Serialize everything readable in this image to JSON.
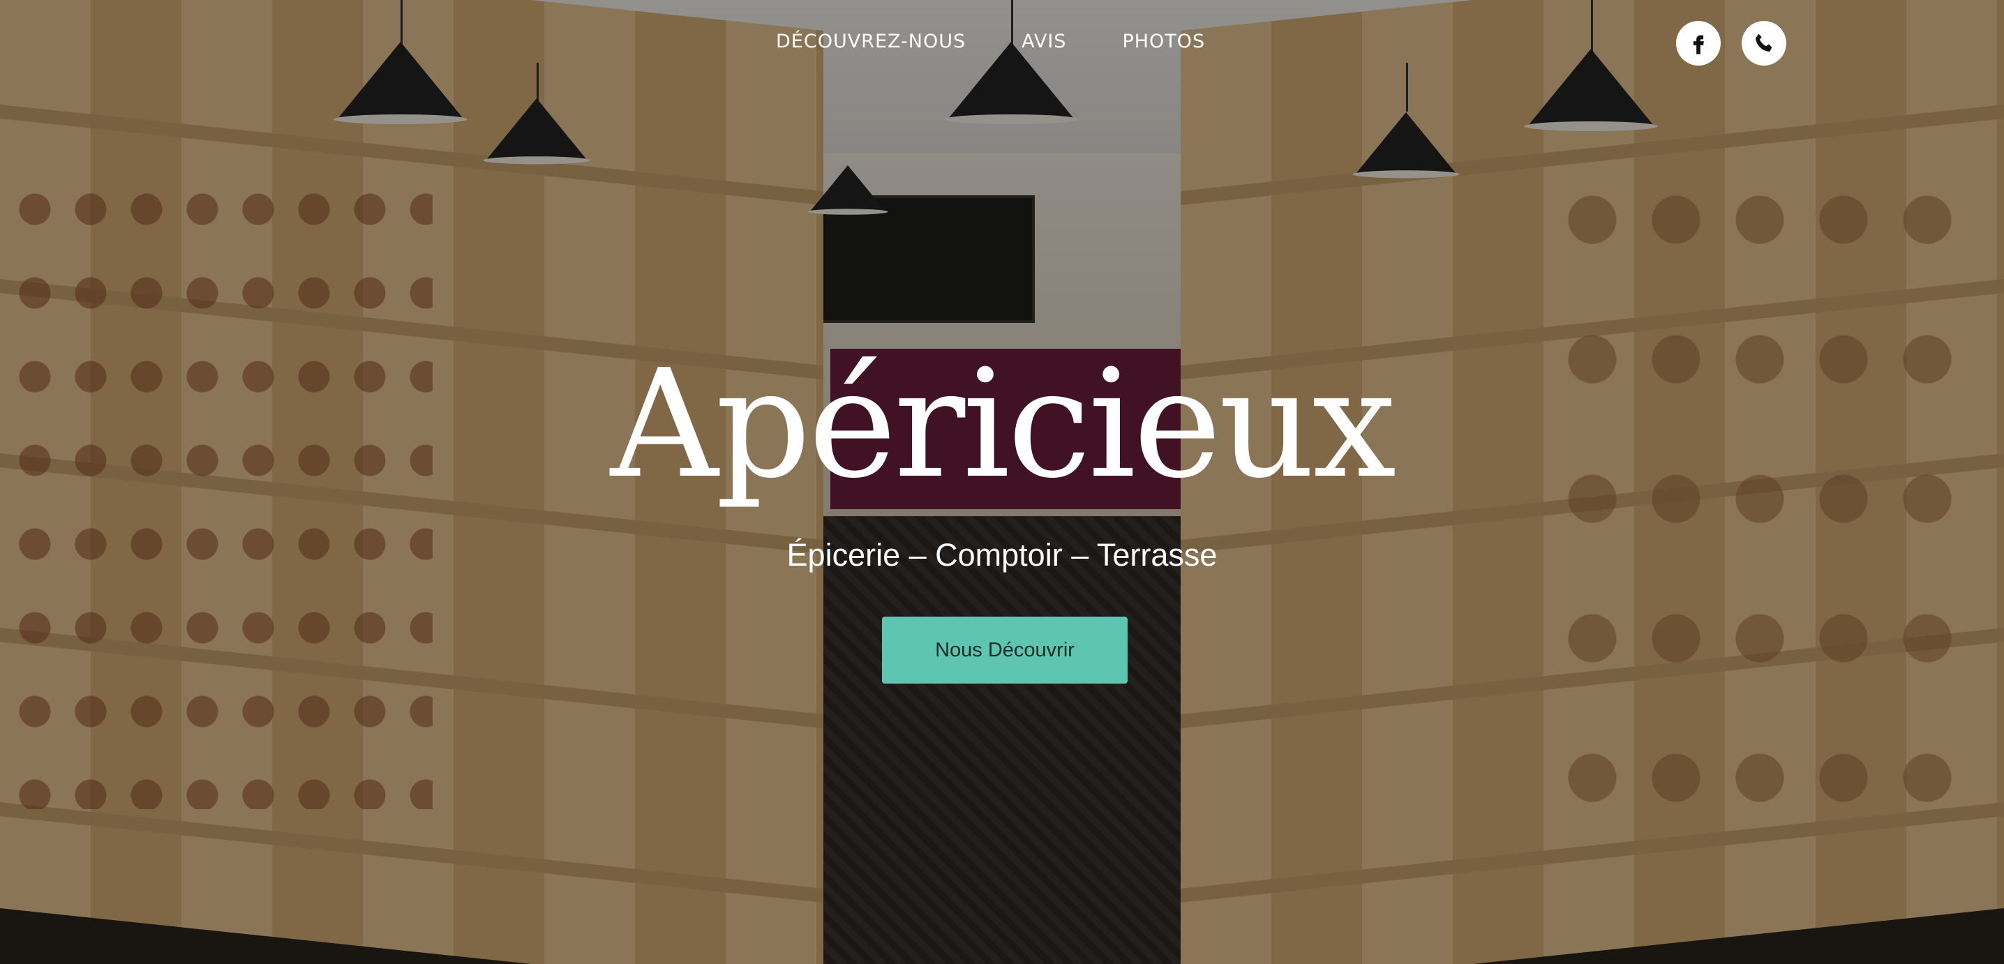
{
  "nav": {
    "items": [
      {
        "label": "DÉCOUVREZ-NOUS"
      },
      {
        "label": "AVIS"
      },
      {
        "label": "PHOTOS"
      }
    ]
  },
  "social": {
    "facebook_icon": "facebook-icon",
    "phone_icon": "phone-icon"
  },
  "hero": {
    "title": "Apéricieux",
    "subtitle": "Épicerie – Comptoir – Terrasse",
    "cta_label": "Nous Découvrir"
  },
  "colors": {
    "accent": "#5ec5b0",
    "text": "#ffffff",
    "cta_text": "#1d2b28"
  }
}
